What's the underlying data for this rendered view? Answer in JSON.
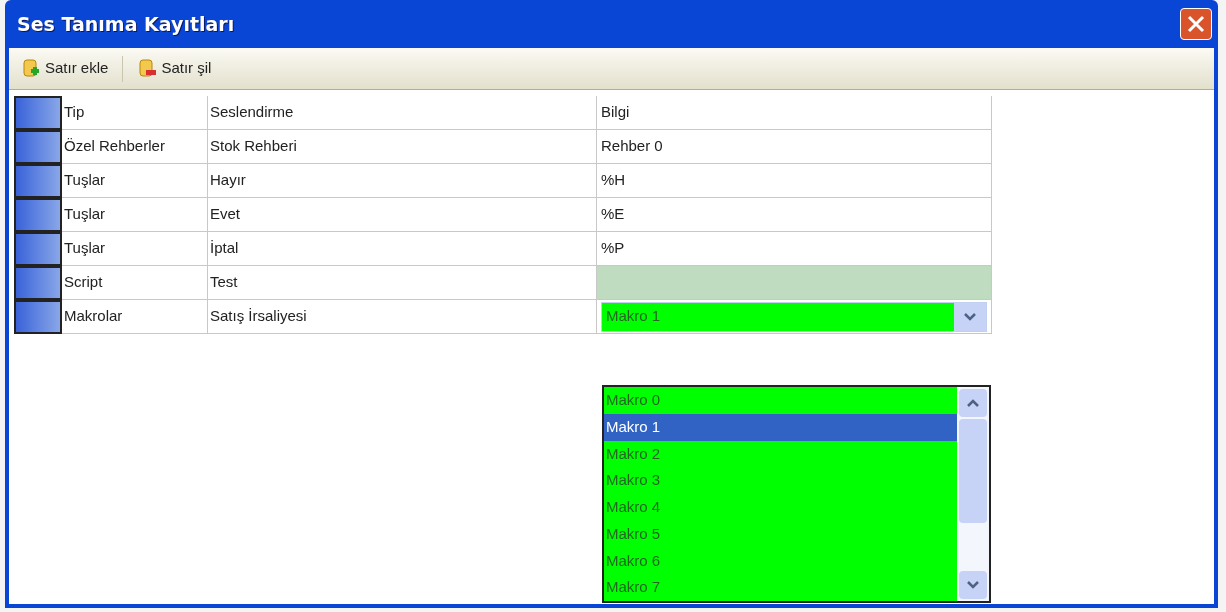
{
  "window": {
    "title": "Ses Tanıma Kayıtları"
  },
  "toolbar": [
    {
      "label": "Satır ekle",
      "kind": "add"
    },
    {
      "label": "Satır şil",
      "kind": "remove"
    }
  ],
  "rows": [
    {
      "column_1": "Tip",
      "column_2": "Seslendirme",
      "column_3": {
        "kind": "text",
        "value": "Bilgi"
      }
    },
    {
      "column_1": "Özel Rehberler",
      "column_2": "Stok Rehberi",
      "column_3": {
        "kind": "text",
        "value": "Rehber 0"
      }
    },
    {
      "column_1": "Tuşlar",
      "column_2": "Hayır",
      "column_3": {
        "kind": "text",
        "value": "%H"
      }
    },
    {
      "column_1": "Tuşlar",
      "column_2": "Evet",
      "column_3": {
        "kind": "text",
        "value": "%E"
      }
    },
    {
      "column_1": "Tuşlar",
      "column_2": "İptal",
      "column_3": {
        "kind": "text",
        "value": "%P"
      }
    },
    {
      "column_1": "Script",
      "column_2": "Test",
      "column_3": {
        "kind": "blank"
      }
    },
    {
      "column_1": "Makrolar",
      "column_2": "Satış İrsaliyesi",
      "column_3": {
        "kind": "combo",
        "value": "Makro 1"
      }
    }
  ],
  "dropdown": {
    "options": [
      {
        "label": "Makro 0",
        "selected": false
      },
      {
        "label": "Makro 1",
        "selected": true
      },
      {
        "label": "Makro 2",
        "selected": false
      },
      {
        "label": "Makro 3",
        "selected": false
      },
      {
        "label": "Makro 4",
        "selected": false
      },
      {
        "label": "Makro 5",
        "selected": false
      },
      {
        "label": "Makro 6",
        "selected": false
      },
      {
        "label": "Makro 7",
        "selected": false
      }
    ]
  }
}
